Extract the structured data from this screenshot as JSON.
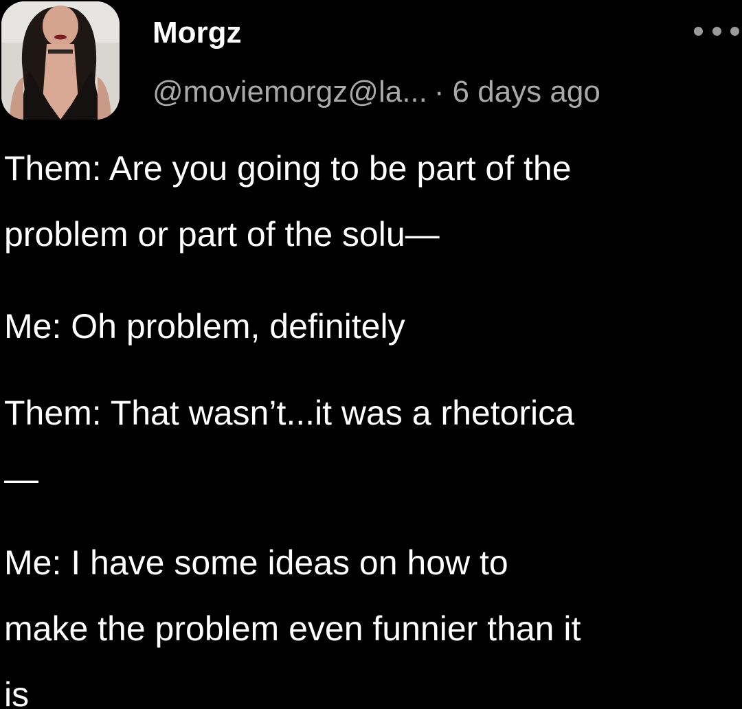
{
  "post": {
    "author": {
      "display_name": "Morgz",
      "handle": "@moviemorgz@la...",
      "avatar_icon": "profile-photo"
    },
    "separator": "·",
    "timestamp": "6 days ago",
    "more_icon": "ellipsis-icon",
    "body_lines": [
      "Them: Are you going to be part of the",
      "problem or part of the solu—",
      "Me: Oh problem, definitely",
      "Them: That wasn’t...it was a rhetorica",
      "—",
      "Me: I have some ideas on how to",
      "make the problem even funnier than it",
      "is"
    ]
  },
  "colors": {
    "background": "#000000",
    "text": "#ffffff",
    "muted": "#a9a9a9"
  }
}
